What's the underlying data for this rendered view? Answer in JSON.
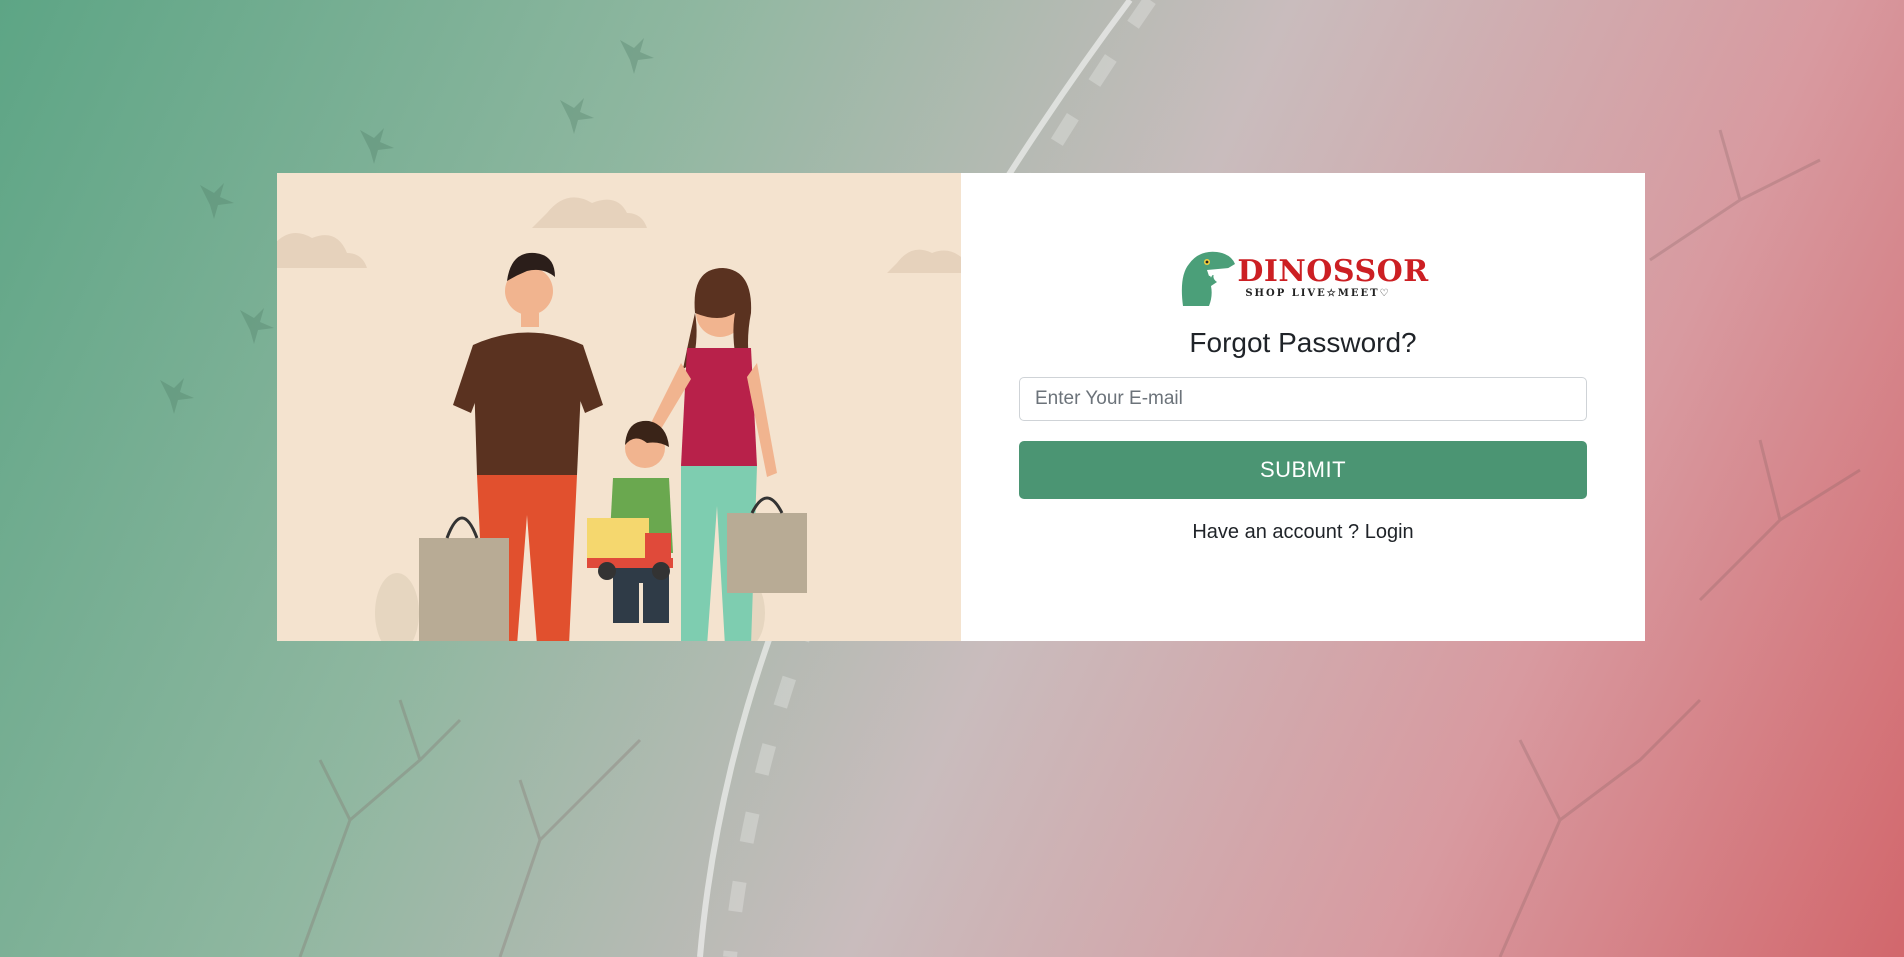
{
  "brand": {
    "name": "DINOSSOR",
    "tagline": "SHOP LIVE☆MEET♡",
    "accent": "#cc1f23",
    "mascot_color": "#4b9f79"
  },
  "form": {
    "title": "Forgot Password?",
    "email_placeholder": "Enter Your E-mail",
    "email_value": "",
    "submit_label": "SUBMIT",
    "account_prompt": "Have an account ?",
    "login_label": "Login"
  },
  "colors": {
    "primary": "#4b9573",
    "illustration_bg": "#f4e3cf"
  }
}
